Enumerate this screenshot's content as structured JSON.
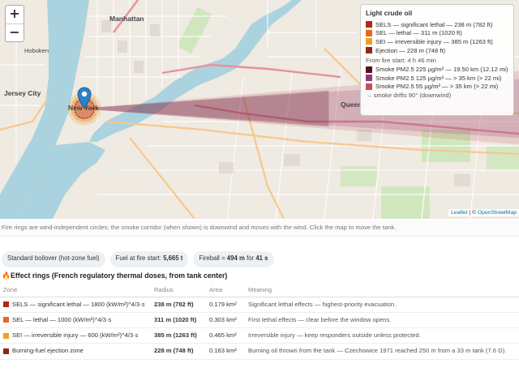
{
  "map": {
    "zoom_in": "+",
    "zoom_out": "−",
    "place_labels": {
      "manhattan": "Manhattan",
      "hoboken": "Hoboken",
      "jersey_city": "Jersey City",
      "new_york": "New York",
      "queens": "Queens"
    },
    "attribution": {
      "leaflet": "Leaflet",
      "separator": " | © ",
      "osm": "OpenStreetMap"
    }
  },
  "legend": {
    "title": "Light crude oil",
    "rings": [
      {
        "label": "SELS — significant lethal — 238 m (782 ft)",
        "color": "#b3261e"
      },
      {
        "label": "SEL — lethal — 311 m (1020 ft)",
        "color": "#e8691d"
      },
      {
        "label": "SEI — irreversible injury — 385 m (1263 ft)",
        "color": "#f0a020"
      },
      {
        "label": "Ejection — 228 m (748 ft)",
        "color": "#8b2a1a"
      }
    ],
    "fire_start": "From fire start: 4 h 46 min",
    "smoke": [
      {
        "label": "Smoke PM2.5 225 µg/m³ — 19.50 km (12.12 mi)",
        "color": "#5a1024"
      },
      {
        "label": "Smoke PM2.5 125 µg/m³ — > 35 km (> 22 mi)",
        "color": "#8e3a7a"
      },
      {
        "label": "Smoke PM2.5 55 µg/m³ — > 35 km (> 22 mi)",
        "color": "#c0505a"
      }
    ],
    "drift": "→ smoke drifts 90° (downwind)"
  },
  "caption": "Fire rings are wind-independent circles; the smoke corridor (when shown) is downwind and moves with the wind. Click the map to move the tank.",
  "chips": {
    "boilover": "Standard boilover (hot-zone fuel)",
    "fuel_label": "Fuel at fire start: ",
    "fuel_value": "5,665 t",
    "fireball_label": "Fireball = ",
    "fireball_value": "494 m",
    "fireball_for": " for ",
    "fireball_time": "41 s"
  },
  "section_title": "Effect rings (French regulatory thermal doses, from tank center)",
  "table": {
    "headers": [
      "Zone",
      "Radius",
      "Area",
      "Meaning"
    ],
    "rows": [
      {
        "zone": "SELS — significant lethal — 1800 (kW/m²)^4/3·s",
        "color": "#b3261e",
        "radius": "238 m (782 ft)",
        "area": "0.179 km²",
        "meaning": "Significant lethal effects — highest-priority evacuation."
      },
      {
        "zone": "SEL — lethal — 1000 (kW/m²)^4/3·s",
        "color": "#e8691d",
        "radius": "311 m (1020 ft)",
        "area": "0.303 km²",
        "meaning": "First lethal effects — clear before the window opens."
      },
      {
        "zone": "SEI — irreversible injury — 600 (kW/m²)^4/3·s",
        "color": "#f0a020",
        "radius": "385 m (1263 ft)",
        "area": "0.465 km²",
        "meaning": "Irreversible injury — keep responders outside unless protected."
      },
      {
        "zone": "Burning-fuel ejection zone",
        "color": "#8b2a1a",
        "radius": "228 m (748 ft)",
        "area": "0.163 km²",
        "meaning": "Burning oil thrown from the tank — Czechowice 1971 reached 250 m from a 33 m tank (7.6 D)."
      }
    ]
  }
}
